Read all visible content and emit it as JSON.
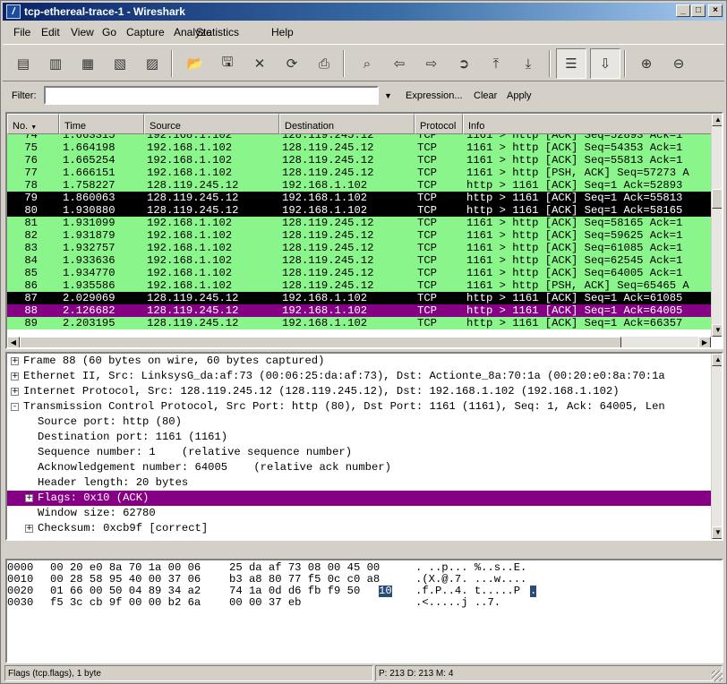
{
  "window": {
    "title": "tcp-ethereal-trace-1 - Wireshark"
  },
  "menu": [
    "File",
    "Edit",
    "View",
    "Go",
    "Capture",
    "Analyze",
    "Statistics",
    "Help"
  ],
  "filter": {
    "label": "Filter:",
    "value": "",
    "expression": "Expression...",
    "clear": "Clear",
    "apply": "Apply"
  },
  "packet_list": {
    "columns": [
      "No. ",
      "Time",
      "Source",
      "Destination",
      "Protocol",
      "Info"
    ],
    "rows": [
      {
        "no": "74",
        "time": "1.663315",
        "src": "192.168.1.102",
        "dst": "128.119.245.12",
        "proto": "TCP",
        "info": "1161 > http [ACK] Seq=52893 Ack=1",
        "style": "green"
      },
      {
        "no": "75",
        "time": "1.664198",
        "src": "192.168.1.102",
        "dst": "128.119.245.12",
        "proto": "TCP",
        "info": "1161 > http [ACK] Seq=54353 Ack=1",
        "style": "green"
      },
      {
        "no": "76",
        "time": "1.665254",
        "src": "192.168.1.102",
        "dst": "128.119.245.12",
        "proto": "TCP",
        "info": "1161 > http [ACK] Seq=55813 Ack=1",
        "style": "green"
      },
      {
        "no": "77",
        "time": "1.666151",
        "src": "192.168.1.102",
        "dst": "128.119.245.12",
        "proto": "TCP",
        "info": "1161 > http [PSH, ACK] Seq=57273 A",
        "style": "green"
      },
      {
        "no": "78",
        "time": "1.758227",
        "src": "128.119.245.12",
        "dst": "192.168.1.102",
        "proto": "TCP",
        "info": "http > 1161 [ACK] Seq=1 Ack=52893",
        "style": "green"
      },
      {
        "no": "79",
        "time": "1.860063",
        "src": "128.119.245.12",
        "dst": "192.168.1.102",
        "proto": "TCP",
        "info": "http > 1161 [ACK] Seq=1 Ack=55813",
        "style": "black"
      },
      {
        "no": "80",
        "time": "1.930880",
        "src": "128.119.245.12",
        "dst": "192.168.1.102",
        "proto": "TCP",
        "info": "http > 1161 [ACK] Seq=1 Ack=58165",
        "style": "black"
      },
      {
        "no": "81",
        "time": "1.931099",
        "src": "192.168.1.102",
        "dst": "128.119.245.12",
        "proto": "TCP",
        "info": "1161 > http [ACK] Seq=58165 Ack=1",
        "style": "green"
      },
      {
        "no": "82",
        "time": "1.931879",
        "src": "192.168.1.102",
        "dst": "128.119.245.12",
        "proto": "TCP",
        "info": "1161 > http [ACK] Seq=59625 Ack=1",
        "style": "green"
      },
      {
        "no": "83",
        "time": "1.932757",
        "src": "192.168.1.102",
        "dst": "128.119.245.12",
        "proto": "TCP",
        "info": "1161 > http [ACK] Seq=61085 Ack=1",
        "style": "green"
      },
      {
        "no": "84",
        "time": "1.933636",
        "src": "192.168.1.102",
        "dst": "128.119.245.12",
        "proto": "TCP",
        "info": "1161 > http [ACK] Seq=62545 Ack=1",
        "style": "green"
      },
      {
        "no": "85",
        "time": "1.934770",
        "src": "192.168.1.102",
        "dst": "128.119.245.12",
        "proto": "TCP",
        "info": "1161 > http [ACK] Seq=64005 Ack=1",
        "style": "green"
      },
      {
        "no": "86",
        "time": "1.935586",
        "src": "192.168.1.102",
        "dst": "128.119.245.12",
        "proto": "TCP",
        "info": "1161 > http [PSH, ACK] Seq=65465 A",
        "style": "green"
      },
      {
        "no": "87",
        "time": "2.029069",
        "src": "128.119.245.12",
        "dst": "192.168.1.102",
        "proto": "TCP",
        "info": "http > 1161 [ACK] Seq=1 Ack=61085",
        "style": "black"
      },
      {
        "no": "88",
        "time": "2.126682",
        "src": "128.119.245.12",
        "dst": "192.168.1.102",
        "proto": "TCP",
        "info": "http > 1161 [ACK] Seq=1 Ack=64005",
        "style": "selected"
      },
      {
        "no": "89",
        "time": "2.203195",
        "src": "128.119.245.12",
        "dst": "192.168.1.102",
        "proto": "TCP",
        "info": "http > 1161 [ACK] Seq=1 Ack=66357",
        "style": "green"
      }
    ]
  },
  "details": [
    {
      "text": "Frame 88 (60 bytes on wire, 60 bytes captured)",
      "indent": 0,
      "expander": "+"
    },
    {
      "text": "Ethernet II, Src: LinksysG_da:af:73 (00:06:25:da:af:73), Dst: Actionte_8a:70:1a (00:20:e0:8a:70:1a",
      "indent": 0,
      "expander": "+"
    },
    {
      "text": "Internet Protocol, Src: 128.119.245.12 (128.119.245.12), Dst: 192.168.1.102 (192.168.1.102)",
      "indent": 0,
      "expander": "+"
    },
    {
      "text": "Transmission Control Protocol, Src Port: http (80), Dst Port: 1161 (1161), Seq: 1, Ack: 64005, Len",
      "indent": 0,
      "expander": "-"
    },
    {
      "text": "Source port: http (80)",
      "indent": 1,
      "expander": ""
    },
    {
      "text": "Destination port: 1161 (1161)",
      "indent": 1,
      "expander": ""
    },
    {
      "text": "Sequence number: 1    (relative sequence number)",
      "indent": 1,
      "expander": ""
    },
    {
      "text": "Acknowledgement number: 64005    (relative ack number)",
      "indent": 1,
      "expander": ""
    },
    {
      "text": "Header length: 20 bytes",
      "indent": 1,
      "expander": ""
    },
    {
      "text": "Flags: 0x10 (ACK)",
      "indent": 1,
      "expander": "+",
      "selected": true
    },
    {
      "text": "Window size: 62780",
      "indent": 1,
      "expander": ""
    },
    {
      "text": "Checksum: 0xcb9f [correct]",
      "indent": 1,
      "expander": "+"
    }
  ],
  "hexdump": [
    {
      "offset": "0000",
      "hex_a": "00 20 e0 8a 70 1a 00 06",
      "hex_b": "25 da af 73 08 00 45 00",
      "hex_hl": "",
      "ascii": ". ..p... %..s..E.",
      "ascii_hl": ""
    },
    {
      "offset": "0010",
      "hex_a": "00 28 58 95 40 00 37 06",
      "hex_b": "b3 a8 80 77 f5 0c c0 a8",
      "hex_hl": "",
      "ascii": ".(X.@.7. ...w....",
      "ascii_hl": ""
    },
    {
      "offset": "0020",
      "hex_a": "01 66 00 50 04 89 34 a2",
      "hex_b": "74 1a 0d d6 fb f9 50",
      "hex_hl": "10",
      "ascii": ".f.P..4. t.....P",
      "ascii_hl": "."
    },
    {
      "offset": "0030",
      "hex_a": "f5 3c cb 9f 00 00 b2 6a",
      "hex_b": "00 00 37 eb",
      "hex_hl": "",
      "ascii": ".<.....j ..7.",
      "ascii_hl": ""
    }
  ],
  "status": {
    "left": "Flags (tcp.flags), 1 byte",
    "right": "P: 213 D: 213 M: 4"
  },
  "colors": {
    "row_green": "#8af58a",
    "row_black": "#000000",
    "row_selected": "#850085",
    "titlebar": "#0a246a"
  }
}
